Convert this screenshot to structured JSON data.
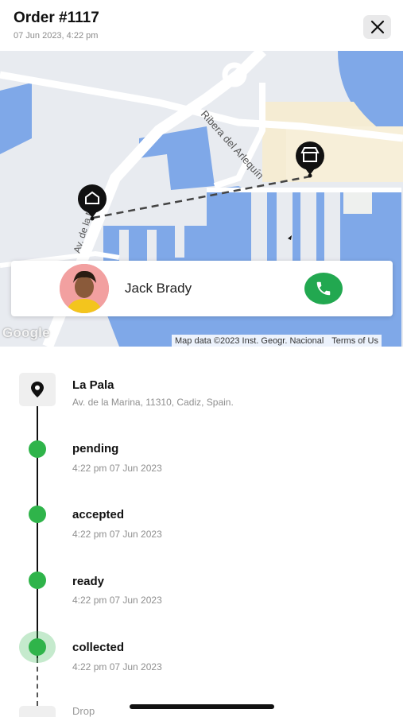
{
  "header": {
    "title": "Order #1117",
    "date": "07 Jun 2023, 4:22 pm",
    "close_icon": "close-icon"
  },
  "map": {
    "street_labels": [
      "Ribera del Arlequín",
      "Av. de la Ma"
    ],
    "provider_logo": "Google",
    "attribution": "Map data ©2023 Inst. Geogr. Nacional",
    "terms": "Terms of Us",
    "markers": [
      "home-marker-icon",
      "store-marker-icon"
    ],
    "colors": {
      "water": "#7fa8e8",
      "land": "#e8ebf0",
      "road": "#ffffff",
      "beach": "#f5ecd3",
      "route": "#444444"
    }
  },
  "contact": {
    "name": "Jack Brady",
    "call_icon": "phone-icon",
    "call_color": "#22a850"
  },
  "timeline": {
    "location": {
      "name": "La Pala",
      "address": "Av. de la Marina, 11310, Cadiz, Spain."
    },
    "steps": [
      {
        "status": "pending",
        "time": "4:22 pm 07 Jun 2023"
      },
      {
        "status": "accepted",
        "time": "4:22 pm 07 Jun 2023"
      },
      {
        "status": "ready",
        "time": "4:22 pm 07 Jun 2023"
      },
      {
        "status": "collected",
        "time": "4:22 pm 07 Jun 2023"
      }
    ],
    "next_step": "Drop",
    "dot_color": "#2fb44a"
  }
}
